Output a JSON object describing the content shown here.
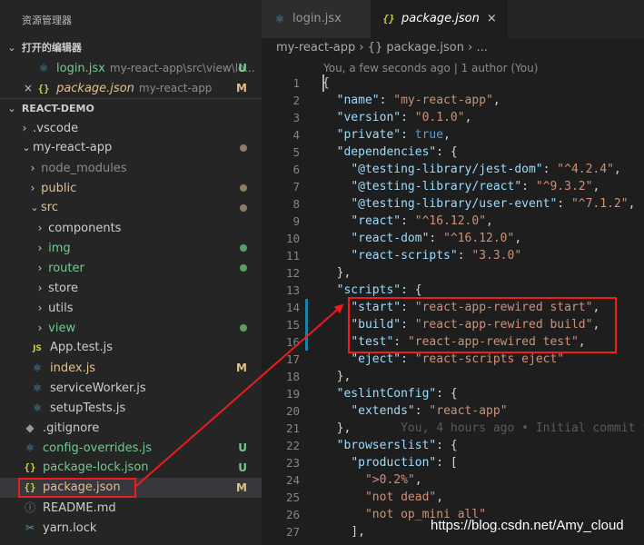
{
  "sidebar": {
    "title": "资源管理器",
    "open_editors": {
      "label": "打开的编辑器",
      "items": [
        {
          "name": "login.jsx",
          "path": "my-react-app\\src\\view\\lo...",
          "badge": "U"
        },
        {
          "name": "package.json",
          "path": "my-react-app",
          "badge": "M"
        }
      ]
    },
    "workspace": {
      "label": "REACT-DEMO",
      "tree": [
        {
          "label": ".vscode"
        },
        {
          "label": "my-react-app"
        },
        {
          "label": "node_modules"
        },
        {
          "label": "public"
        },
        {
          "label": "src"
        },
        {
          "label": "components"
        },
        {
          "label": "img"
        },
        {
          "label": "router"
        },
        {
          "label": "store"
        },
        {
          "label": "utils"
        },
        {
          "label": "view"
        },
        {
          "label": "App.test.js"
        },
        {
          "label": "index.js",
          "badge": "M"
        },
        {
          "label": "serviceWorker.js"
        },
        {
          "label": "setupTests.js"
        },
        {
          "label": ".gitignore"
        },
        {
          "label": "config-overrides.js",
          "badge": "U"
        },
        {
          "label": "package-lock.json",
          "badge": "U"
        },
        {
          "label": "package.json",
          "badge": "M"
        },
        {
          "label": "README.md"
        },
        {
          "label": "yarn.lock"
        }
      ]
    }
  },
  "editor": {
    "tabs": [
      {
        "label": "login.jsx"
      },
      {
        "label": "package.json",
        "close": "×"
      }
    ],
    "breadcrumb": "my-react-app  ›  {} package.json  ›  ...",
    "blame": "You, a few seconds ago | 1 author (You)",
    "lines": [
      {
        "n": "1"
      },
      {
        "n": "2"
      },
      {
        "n": "3"
      },
      {
        "n": "4"
      },
      {
        "n": "5"
      },
      {
        "n": "6"
      },
      {
        "n": "7"
      },
      {
        "n": "8"
      },
      {
        "n": "9"
      },
      {
        "n": "10"
      },
      {
        "n": "11"
      },
      {
        "n": "12"
      },
      {
        "n": "13"
      },
      {
        "n": "14"
      },
      {
        "n": "15"
      },
      {
        "n": "16"
      },
      {
        "n": "17"
      },
      {
        "n": "18"
      },
      {
        "n": "19"
      },
      {
        "n": "20"
      },
      {
        "n": "21"
      },
      {
        "n": "22"
      },
      {
        "n": "23"
      },
      {
        "n": "24"
      },
      {
        "n": "25"
      },
      {
        "n": "26"
      },
      {
        "n": "27"
      }
    ],
    "code": {
      "l2_key": "\"name\"",
      "l2_val": "\"my-react-app\"",
      "l3_key": "\"version\"",
      "l3_val": "\"0.1.0\"",
      "l4_key": "\"private\"",
      "l4_val": "true",
      "l5_key": "\"dependencies\"",
      "l6_key": "\"@testing-library/jest-dom\"",
      "l6_val": "\"^4.2.4\"",
      "l7_key": "\"@testing-library/react\"",
      "l7_val": "\"^9.3.2\"",
      "l8_key": "\"@testing-library/user-event\"",
      "l8_val": "\"^7.1.2\"",
      "l9_key": "\"react\"",
      "l9_val": "\"^16.12.0\"",
      "l10_key": "\"react-dom\"",
      "l10_val": "\"^16.12.0\"",
      "l11_key": "\"react-scripts\"",
      "l11_val": "\"3.3.0\"",
      "l13_key": "\"scripts\"",
      "l14_key": "\"start\"",
      "l14_val": "\"react-app-rewired start\"",
      "l15_key": "\"build\"",
      "l15_val": "\"react-app-rewired build\"",
      "l16_key": "\"test\"",
      "l16_val": "\"react-app-rewired test\"",
      "l17_key": "\"eject\"",
      "l17_val": "\"react-scripts eject\"",
      "l19_key": "\"eslintConfig\"",
      "l20_key": "\"extends\"",
      "l20_val": "\"react-app\"",
      "l21_blame": "You, 4 hours ago • Initial commit fr",
      "l22_key": "\"browserslist\"",
      "l23_key": "\"production\"",
      "l24_val": "\">0.2%\"",
      "l25_val": "\"not dead\"",
      "l26_val": "\"not op_mini all\""
    }
  },
  "watermark": "https://blog.csdn.net/Amy_cloud",
  "colors": {
    "annotation": "#ee1c1c",
    "modified": "#e2c08d",
    "untracked": "#73c991"
  }
}
